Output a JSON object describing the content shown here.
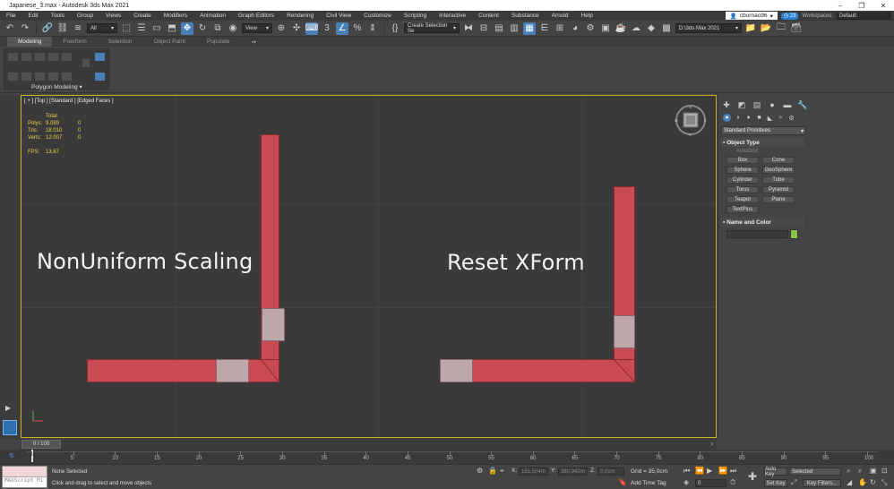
{
  "window": {
    "title": "Japanese_3.max - Autodesk 3ds Max 2021",
    "minimize": "–",
    "maximize": "❐",
    "close": "✕"
  },
  "menu": [
    "File",
    "Edit",
    "Tools",
    "Group",
    "Views",
    "Create",
    "Modifiers",
    "Animation",
    "Graph Editors",
    "Rendering",
    "Civil View",
    "Customize",
    "Scripting",
    "Interactive",
    "Content",
    "Substance",
    "Arnold",
    "Help"
  ],
  "account": {
    "user": "cburnao96",
    "badge": "23",
    "workspaces_label": "Workspaces:",
    "workspace": "Default"
  },
  "toolbar": {
    "selection_filter": "All",
    "ref_coord": "View",
    "selection_set": "Create Selection Se",
    "project_path": "D:\\3ds Max 2021"
  },
  "ribbon": {
    "tabs": [
      "Modeling",
      "Freeform",
      "Selection",
      "Object Paint",
      "Populate"
    ],
    "active_tab": 0,
    "panel_label": "Polygon Modeling ▾"
  },
  "viewport": {
    "label": "[ + ] [Top ] [Standard ] [Edged Faces ]",
    "stats": {
      "header": "Total",
      "rows": [
        {
          "k": "Polys:",
          "a": "9.089",
          "b": "0"
        },
        {
          "k": "Tris:",
          "a": "18.010",
          "b": "0"
        },
        {
          "k": "Verts:",
          "a": "12.007",
          "b": "0"
        }
      ],
      "fps_label": "FPS:",
      "fps": "13,67"
    },
    "left_caption": "NonUniform Scaling",
    "right_caption": "Reset XForm",
    "viewcube_letters": {
      "n": "N",
      "w": "W",
      "e": "E",
      "s": "S"
    }
  },
  "command_panel": {
    "category": "Standard Primitives",
    "object_type_title": "Object Type",
    "autogrid": "AutoGrid",
    "primitives": [
      "Box",
      "Cone",
      "Sphere",
      "GeoSphere",
      "Cylinder",
      "Tube",
      "Torus",
      "Pyramid",
      "Teapot",
      "Plane",
      "TextPlus"
    ],
    "name_color_title": "Name and Color",
    "swatch_color": "#8ac24a"
  },
  "timeline": {
    "frame_display": "0 / 100",
    "ticks": [
      "0",
      "5",
      "10",
      "15",
      "20",
      "25",
      "30",
      "35",
      "40",
      "45",
      "50",
      "55",
      "60",
      "65",
      "70",
      "75",
      "80",
      "85",
      "90",
      "95",
      "100"
    ]
  },
  "status": {
    "maxscript": "MAXScript Mi",
    "selection": "None Selected",
    "prompt": "Click and drag to select and move objects",
    "x_label": "X:",
    "x_value": "151,504m",
    "y_label": "Y:",
    "y_value": "380,942m",
    "z_label": "Z:",
    "z_value": "0,0cm",
    "grid": "Grid = 35,0cm",
    "add_time_tag": "Add Time Tag",
    "auto_key": "Auto Key",
    "set_key": "Set Key",
    "key_mode": "Selected",
    "key_filters": "Key Filters...",
    "current_frame": "0"
  }
}
